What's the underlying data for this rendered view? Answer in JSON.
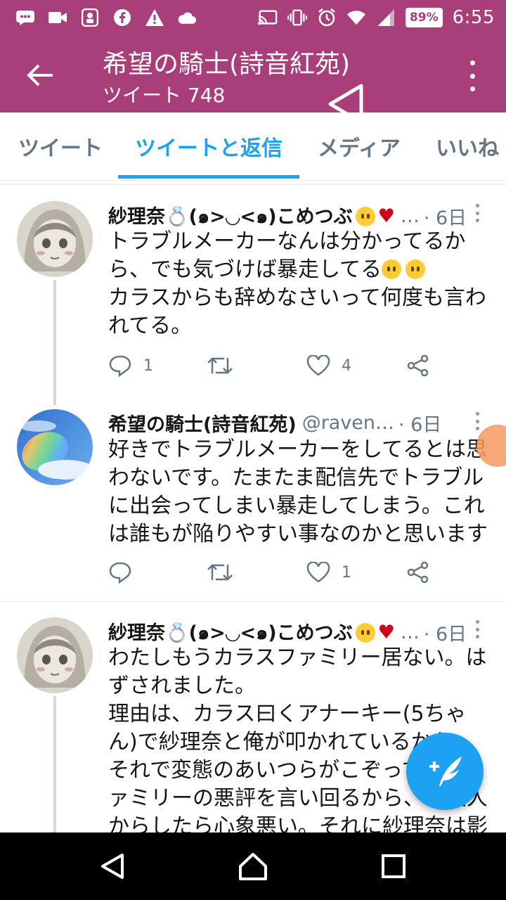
{
  "status_bar": {
    "battery": "89%",
    "time": "6:55"
  },
  "app_bar": {
    "title": "希望の騎士(詩音紅苑)",
    "subtitle": "ツイート 748"
  },
  "tabs": [
    {
      "label": "ツイート",
      "active": false
    },
    {
      "label": "ツイートと返信",
      "active": true
    },
    {
      "label": "メディア",
      "active": false
    },
    {
      "label": "いいね",
      "active": false
    }
  ],
  "tweets": [
    {
      "name": "紗理奈💍(๑>◡<๑)こめつぶ",
      "handle": "…",
      "time": "· 6日",
      "lines": [
        "トラブルメーカーなんは分かってるか",
        "ら、でも気づけば暴走してる",
        "カラスからも辞めなさいって何度も言わ",
        "れてる。"
      ],
      "reply_count": "1",
      "retweet_count": "",
      "like_count": "4"
    },
    {
      "name": "希望の騎士(詩音紅苑)",
      "handle": "@raven…",
      "time": "· 6日",
      "lines": [
        "好きでトラブルメーカーをしてるとは思",
        "わないです。たまたま配信先でトラブル",
        "に出会ってしまい暴走してしまう。これ",
        "は誰もが陥りやすい事なのかと思います"
      ],
      "reply_count": "",
      "retweet_count": "",
      "like_count": "1"
    },
    {
      "name": "紗理奈💍(๑>◡<๑)こめつぶ",
      "handle": "…",
      "time": "· 6日",
      "lines": [
        "わたしもうカラスファミリー居ない。は",
        "ずされました。",
        "理由は、カラス曰くアナーキー(5ちゃ",
        "ん)で紗理奈と俺が叩かれているから",
        "それで変態のあいつらがこぞってファ",
        "ァミリーの悪評を言い回るから、一般人",
        "からしたら心象悪い。それに紗理奈は影"
      ]
    }
  ],
  "icons": {
    "back": "arrow-left-icon",
    "more": "more-vertical-icon",
    "reply": "reply-icon",
    "retweet": "retweet-icon",
    "like": "heart-icon",
    "share": "share-icon",
    "compose": "compose-tweet-icon"
  },
  "colors": {
    "app_bar": "#a83f7a",
    "accent": "#1da1f2"
  }
}
